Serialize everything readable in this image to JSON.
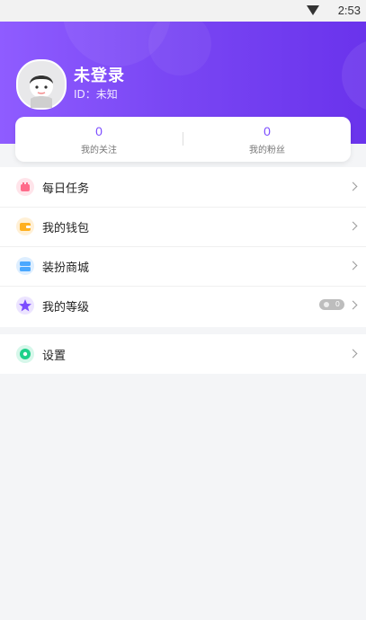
{
  "status_bar": {
    "time": "2:53"
  },
  "profile": {
    "name": "未登录",
    "id_text": "ID：未知"
  },
  "stats": [
    {
      "value": "0",
      "label": "我的关注"
    },
    {
      "value": "0",
      "label": "我的粉丝"
    }
  ],
  "menu": {
    "items": [
      {
        "label": "每日任务",
        "icon": "task-icon",
        "color": "#ff6b8a"
      },
      {
        "label": "我的钱包",
        "icon": "wallet-icon",
        "color": "#ffb020"
      },
      {
        "label": "装扮商城",
        "icon": "store-icon",
        "color": "#4aa8ff"
      },
      {
        "label": "我的等级",
        "icon": "star-icon",
        "color": "#7c4dff",
        "badge": "0"
      }
    ]
  },
  "settings": {
    "label": "设置",
    "icon": "settings-icon",
    "color": "#1fd08a"
  }
}
